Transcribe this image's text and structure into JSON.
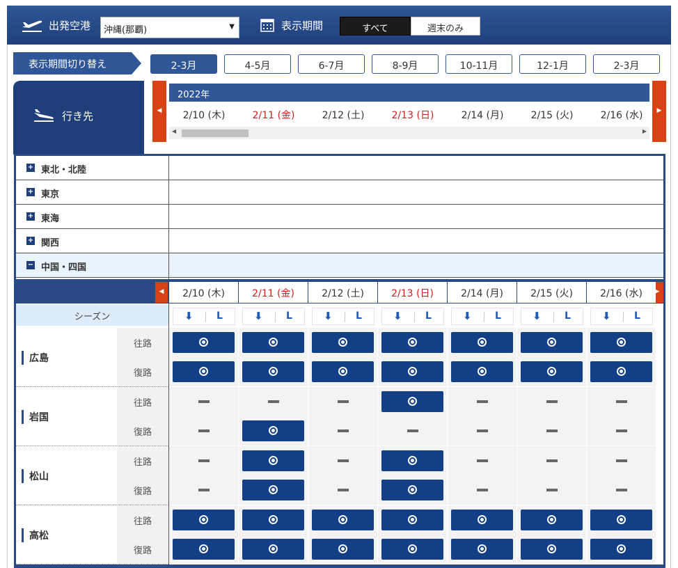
{
  "header": {
    "departure_label": "出発空港",
    "departure_value": "沖縄(那覇)",
    "period_label": "表示期間",
    "toggle_all": "すべて",
    "toggle_weekend": "週末のみ"
  },
  "period_switch": {
    "label": "表示期間切り替え",
    "tabs": [
      "2-3月",
      "4-5月",
      "6-7月",
      "8-9月",
      "10-11月",
      "12-1月",
      "2-3月"
    ],
    "active_index": 0
  },
  "destination": {
    "title": "行き先"
  },
  "calendar": {
    "year": "2022年",
    "dates": [
      {
        "label": "2/10 (木)",
        "holiday": false
      },
      {
        "label": "2/11 (金)",
        "holiday": true
      },
      {
        "label": "2/12 (土)",
        "holiday": false
      },
      {
        "label": "2/13 (日)",
        "holiday": true
      },
      {
        "label": "2/14 (月)",
        "holiday": false
      },
      {
        "label": "2/15 (火)",
        "holiday": false
      },
      {
        "label": "2/16 (水)",
        "holiday": false
      }
    ]
  },
  "regions": [
    {
      "name": "東北・北陸",
      "icon": "plus-icon",
      "sign": "+"
    },
    {
      "name": "東京",
      "icon": "plus-icon",
      "sign": "+"
    },
    {
      "name": "東海",
      "icon": "plus-icon",
      "sign": "+"
    },
    {
      "name": "関西",
      "icon": "plus-icon",
      "sign": "+"
    },
    {
      "name": "中国・四国",
      "icon": "minus-icon",
      "sign": "−",
      "open": true
    }
  ],
  "season_label": "シーズン",
  "season_markers": {
    "arrow": "⬇",
    "letter": "L"
  },
  "direction_labels": {
    "out": "往路",
    "ret": "復路"
  },
  "cities": [
    {
      "name": "広島",
      "out": [
        1,
        1,
        1,
        1,
        1,
        1,
        1
      ],
      "ret": [
        1,
        1,
        1,
        1,
        1,
        1,
        1
      ]
    },
    {
      "name": "岩国",
      "out": [
        0,
        0,
        0,
        1,
        0,
        0,
        0
      ],
      "ret": [
        0,
        1,
        0,
        0,
        0,
        0,
        0
      ]
    },
    {
      "name": "松山",
      "out": [
        0,
        1,
        0,
        1,
        0,
        0,
        0
      ],
      "ret": [
        0,
        1,
        0,
        1,
        0,
        0,
        0
      ]
    },
    {
      "name": "高松",
      "out": [
        1,
        1,
        1,
        1,
        1,
        1,
        1
      ],
      "ret": [
        1,
        1,
        1,
        1,
        1,
        1,
        1
      ]
    }
  ],
  "colors": {
    "brand": "#2f5697",
    "button": "#123f86",
    "holiday": "#cc1f1f",
    "nav": "#d84315"
  }
}
